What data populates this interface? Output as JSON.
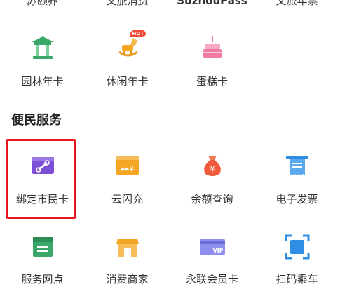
{
  "top_row": [
    {
      "label": "苏颐养"
    },
    {
      "label": "文旅消费"
    },
    {
      "label": "SuzhouPass"
    },
    {
      "label": "文旅年票"
    }
  ],
  "row1": [
    {
      "label": "园林年卡",
      "icon": "pavilion-icon"
    },
    {
      "label": "休闲年卡",
      "icon": "rocking-horse-icon",
      "badge": "HOT"
    },
    {
      "label": "蛋糕卡",
      "icon": "cake-icon"
    }
  ],
  "section": {
    "title": "便民服务"
  },
  "row2": [
    {
      "label": "绑定市民卡",
      "icon": "link-card-icon"
    },
    {
      "label": "云闪充",
      "icon": "card-reader-icon"
    },
    {
      "label": "余额查询",
      "icon": "money-bag-icon"
    },
    {
      "label": "电子发票",
      "icon": "receipt-icon"
    }
  ],
  "row3": [
    {
      "label": "服务网点",
      "icon": "service-point-icon"
    },
    {
      "label": "消费商家",
      "icon": "shop-icon"
    },
    {
      "label": "永联会员卡",
      "icon": "vip-card-icon"
    },
    {
      "label": "扫码乘车",
      "icon": "scan-icon"
    }
  ],
  "colors": {
    "highlight": "#e8141b",
    "green": "#3aa868",
    "orange": "#f5a623",
    "pink": "#f27aa0",
    "purple": "#7b4fd6",
    "red": "#f05a3c",
    "blue": "#2f8de4"
  }
}
